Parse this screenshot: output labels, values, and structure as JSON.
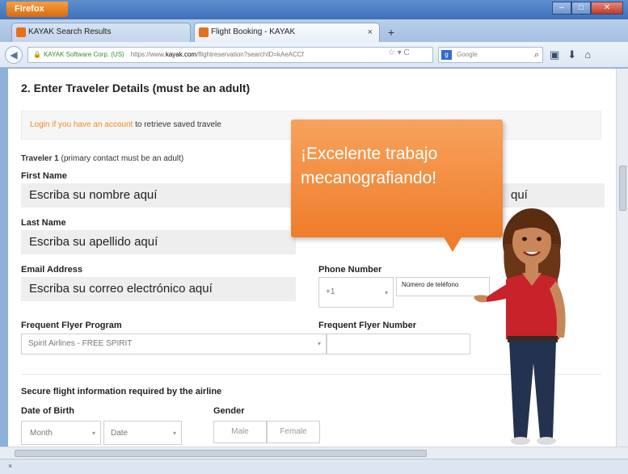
{
  "browser": {
    "menu_button": "Firefox",
    "tabs": [
      {
        "label": "KAYAK Search Results"
      },
      {
        "label": "Flight Booking - KAYAK"
      }
    ],
    "url": {
      "identity": "KAYAK Software Corp. (US)",
      "prefix": "https://www.",
      "host": "kayak.com",
      "path": "/flightreservation?searchID=kAeACCf"
    },
    "search_placeholder": "Google"
  },
  "form": {
    "section_title": "2. Enter Traveler Details (must be an adult)",
    "login_link": "Login if you have an account",
    "login_rest": "to retrieve saved travele",
    "traveler_label": "Traveler 1",
    "traveler_note": "(primary contact must be an adult)",
    "first_name_label": "First Name",
    "first_name_value": "Escriba su nombre aquí",
    "middle_value_partial": "quí",
    "last_name_label": "Last Name",
    "last_name_value": "Escriba su apellido aquí",
    "email_label": "Email Address",
    "email_value": "Escriba su correo electrónico aquí",
    "phone_label": "Phone Number",
    "phone_code": "+1",
    "phone_value": "Número de teléfono",
    "ffp_label": "Frequent Flyer Program",
    "ffp_value": "Spirit Airlines - FREE SPIRIT",
    "ffn_label": "Frequent Flyer Number",
    "secure_title": "Secure flight information required by the airline",
    "dob_label": "Date of Birth",
    "month_value": "Month",
    "date_value": "Date",
    "gender_label": "Gender",
    "male_label": "Male",
    "female_label": "Female"
  },
  "bubble": {
    "line1": "¡Excelente trabajo",
    "line2": "mecanografiando!"
  },
  "colors": {
    "accent_orange": "#ef7d2b",
    "link_orange": "#f08a1c"
  }
}
